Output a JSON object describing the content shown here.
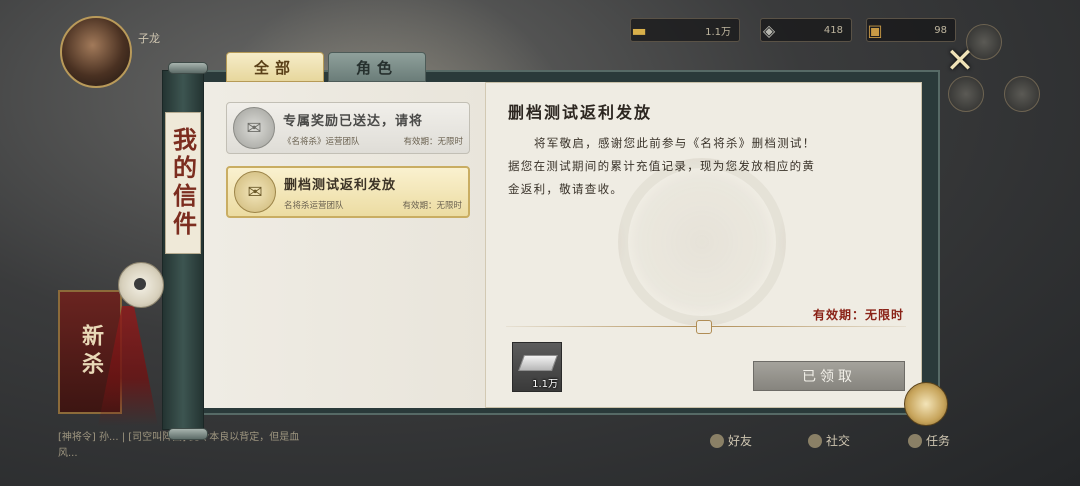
{
  "hud": {
    "player_name": "子龙",
    "resources": [
      {
        "icon": "gold-ingot-icon",
        "value": "1.1万"
      },
      {
        "icon": "coin-icon",
        "value": "418"
      },
      {
        "icon": "chest-icon",
        "value": "98"
      }
    ],
    "left_banner": "新杀",
    "bottom_text": "[神将令] 孙... | [司空叫阵曲] 此令本良以背定，但是血风...",
    "bottom_buttons": [
      "好友",
      "社交",
      "任务"
    ]
  },
  "mailbox": {
    "title": "我的信件",
    "tabs": [
      {
        "label": "全部",
        "active": true
      },
      {
        "label": "角色",
        "active": false
      }
    ],
    "mails": [
      {
        "title": "专属奖励已送达，请将",
        "sender": "《名将杀》运营团队",
        "validity": "有效期：无限时",
        "selected": false
      },
      {
        "title": "删档测试返利发放",
        "sender": "名将杀运营团队",
        "validity": "有效期：无限时",
        "selected": true
      }
    ],
    "detail": {
      "title": "删档测试返利发放",
      "body_line1": "将军敬启，感谢您此前参与《名将杀》删档测试！",
      "body_line2": "据您在测试期间的累计充值记录，现为您发放相应的黄",
      "body_line3": "金返利，敬请查收。",
      "validity": "有效期：无限时",
      "attachment": {
        "name": "silver-ingot",
        "qty": "1.1万"
      },
      "claimed_label": "已领取"
    }
  },
  "colors": {
    "accent_red": "#8a2217",
    "tab_active": "#e7d79d",
    "panel_paper": "#efece3"
  }
}
